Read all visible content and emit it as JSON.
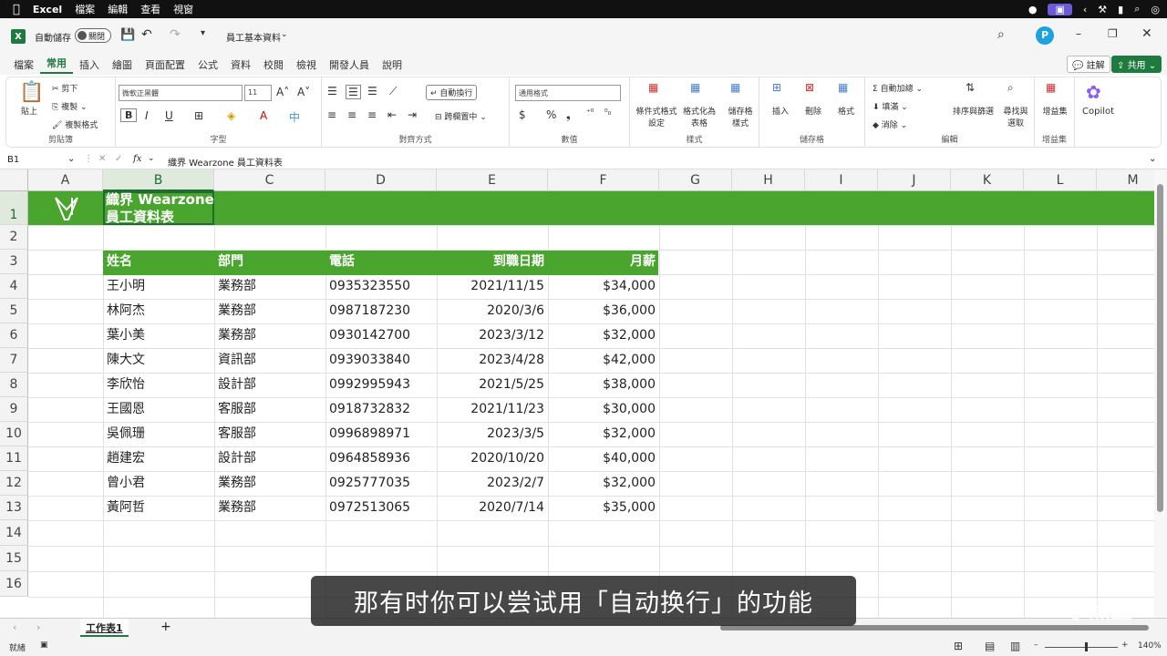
{
  "menubar": {
    "app": "Excel",
    "items": [
      "檔案",
      "編輯",
      "查看",
      "視窗"
    ]
  },
  "titlebar": {
    "autosave_label": "自動儲存",
    "autosave_state": "關閉",
    "doc_title": "員工基本資料"
  },
  "tabs": [
    "檔案",
    "常用",
    "插入",
    "繪圖",
    "頁面配置",
    "公式",
    "資料",
    "校閱",
    "檢視",
    "開發人員",
    "說明"
  ],
  "active_tab": "常用",
  "top_buttons": {
    "comment": "註解",
    "share": "共用"
  },
  "ribbon": {
    "clipboard": {
      "paste": "貼上",
      "cut": "剪下",
      "copy": "複製",
      "format_painter": "複製格式",
      "label": "剪貼簿"
    },
    "font": {
      "name": "微軟正黑體",
      "size": "11",
      "bold": "B",
      "italic": "I",
      "underline": "U",
      "label": "字型"
    },
    "alignment": {
      "wrap": "自動換行",
      "merge": "跨欄置中",
      "label": "對齊方式"
    },
    "number": {
      "format": "通用格式",
      "label": "數值"
    },
    "styles": {
      "conditional": "條件式格式設定",
      "table": "格式化為表格",
      "cell": "儲存格樣式",
      "label": "樣式"
    },
    "cells": {
      "insert": "插入",
      "delete": "刪除",
      "format": "格式",
      "label": "儲存格"
    },
    "editing": {
      "autosum": "自動加總",
      "fill": "填滿",
      "clear": "消除",
      "sort": "排序與篩選",
      "find": "尋找與選取",
      "label": "編輯"
    },
    "addins": {
      "addin": "增益集",
      "label": "增益集"
    },
    "copilot": "Copilot"
  },
  "formula_bar": {
    "name_box": "B1",
    "fx": "fx",
    "content": "織界 Wearzone 員工資料表"
  },
  "columns": [
    "A",
    "B",
    "C",
    "D",
    "E",
    "F",
    "G",
    "H",
    "I",
    "J",
    "K",
    "L",
    "M"
  ],
  "rows": [
    "1",
    "2",
    "3",
    "4",
    "5",
    "6",
    "7",
    "8",
    "9",
    "10",
    "11",
    "12",
    "13",
    "14",
    "15",
    "16"
  ],
  "title": {
    "line1": "織界 Wearzone",
    "line2": "員工資料表"
  },
  "table_headers": [
    "姓名",
    "部門",
    "電話",
    "到職日期",
    "月薪"
  ],
  "table_rows": [
    [
      "王小明",
      "業務部",
      "0935323550",
      "2021/11/15",
      "$34,000"
    ],
    [
      "林阿杰",
      "業務部",
      "0987187230",
      "2020/3/6",
      "$36,000"
    ],
    [
      "葉小美",
      "業務部",
      "0930142700",
      "2023/3/12",
      "$32,000"
    ],
    [
      "陳大文",
      "資訊部",
      "0939033840",
      "2023/4/28",
      "$42,000"
    ],
    [
      "李欣怡",
      "設計部",
      "0992995943",
      "2021/5/25",
      "$38,000"
    ],
    [
      "王國恩",
      "客服部",
      "0918732832",
      "2021/11/23",
      "$30,000"
    ],
    [
      "吳佩珊",
      "客服部",
      "0996898971",
      "2023/3/5",
      "$32,000"
    ],
    [
      "趙建宏",
      "設計部",
      "0964858936",
      "2020/10/20",
      "$40,000"
    ],
    [
      "曾小君",
      "業務部",
      "0925777035",
      "2023/2/7",
      "$32,000"
    ],
    [
      "黃阿哲",
      "業務部",
      "0972513065",
      "2020/7/14",
      "$35,000"
    ]
  ],
  "sheet_tab": "工作表1",
  "status": {
    "ready": "就緒",
    "zoom": "140%"
  },
  "subtitle": "那有时你可以尝试用「自动换行」的功能",
  "watermark": "小黑盒",
  "colors": {
    "green": "#4aa52e",
    "excel": "#1f7a3f"
  }
}
